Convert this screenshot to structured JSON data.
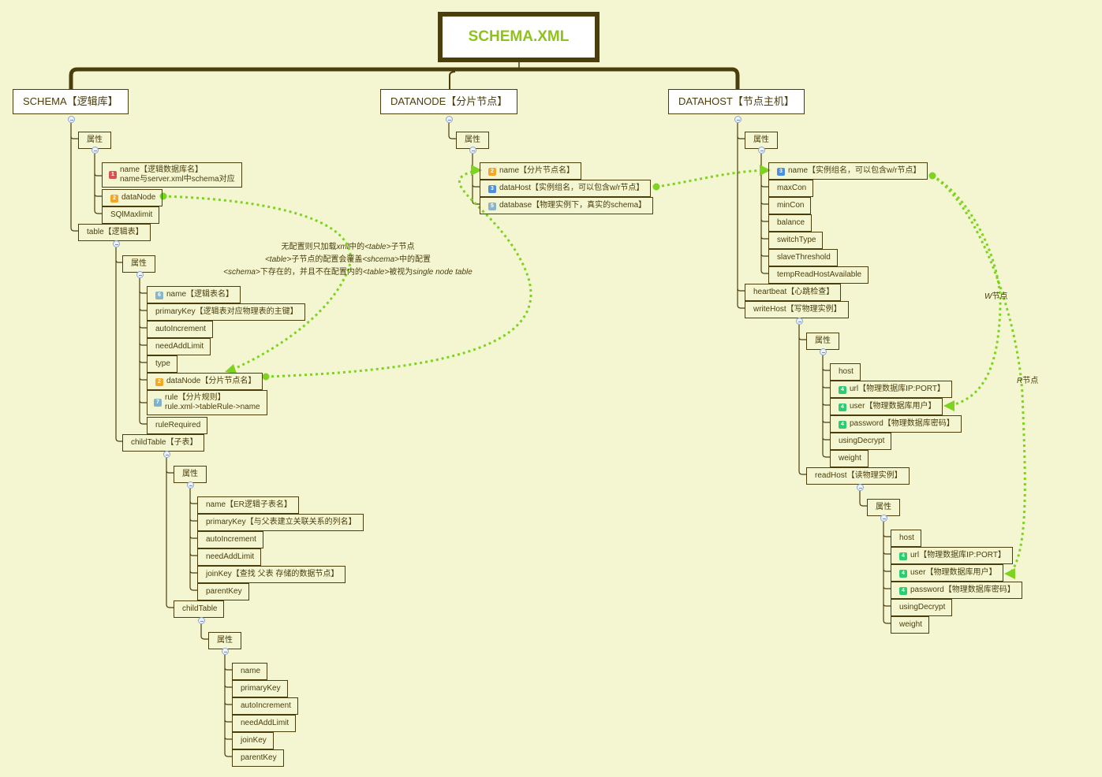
{
  "root": {
    "title": "SCHEMA.XML",
    "title_color": "#8fc21b"
  },
  "colors": {
    "line": "#4a3e0c",
    "relationship": "#7ed321",
    "background": "#f4f6d2"
  },
  "schema": {
    "title": "SCHEMA【逻辑库】",
    "attrs_label": "属性",
    "attrs": [
      {
        "badge": "1",
        "badge_color": "#d9534f",
        "line1": "name【逻辑数据库名】",
        "line2": "name与server.xml中schema对应"
      },
      {
        "badge": "2",
        "badge_color": "#f5a623",
        "label": "dataNode"
      },
      {
        "label": "SQlMaxlimit"
      }
    ],
    "table": {
      "title": "table【逻辑表】",
      "attrs_label": "属性",
      "attrs": [
        {
          "badge": "6",
          "badge_color": "#8ab4c8",
          "label": "name【逻辑表名】"
        },
        {
          "label": "primaryKey【逻辑表对应物理表的主键】"
        },
        {
          "label": "autoIncrement"
        },
        {
          "label": "needAddLimit"
        },
        {
          "label": "type"
        },
        {
          "badge": "2",
          "badge_color": "#f5a623",
          "label": "dataNode【分片节点名】"
        },
        {
          "badge": "7",
          "badge_color": "#7fb3cc",
          "line1": "rule【分片规则】",
          "line2": "rule.xml->tableRule->name"
        },
        {
          "label": "ruleRequired"
        }
      ],
      "childTable": {
        "title": "childTable【子表】",
        "attrs_label": "属性",
        "attrs": [
          {
            "label": "name【ER逻辑子表名】"
          },
          {
            "label": "primaryKey【与父表建立关联关系的列名】"
          },
          {
            "label": "autoIncrement"
          },
          {
            "label": "needAddLimit"
          },
          {
            "label": "joinKey【查找 父表 存储的数据节点】"
          },
          {
            "label": "parentKey"
          }
        ],
        "childTable": {
          "title": "childTable",
          "attrs_label": "属性",
          "attrs": [
            {
              "label": "name"
            },
            {
              "label": "primaryKey"
            },
            {
              "label": "autoIncrement"
            },
            {
              "label": "needAddLimit"
            },
            {
              "label": "joinKey"
            },
            {
              "label": "parentKey"
            }
          ]
        }
      }
    }
  },
  "datanode": {
    "title": "DATANODE【分片节点】",
    "attrs_label": "属性",
    "attrs": [
      {
        "badge": "2",
        "badge_color": "#f5a623",
        "label": "name【分片节点名】"
      },
      {
        "badge": "3",
        "badge_color": "#4a90e2",
        "label": "dataHost【实例组名，可以包含w/r节点】"
      },
      {
        "badge": "5",
        "badge_color": "#8ab4c8",
        "label": "database【物理实例下，真实的schema】"
      }
    ]
  },
  "datahost": {
    "title": "DATAHOST【节点主机】",
    "attrs_label": "属性",
    "attrs": [
      {
        "badge": "3",
        "badge_color": "#4a90e2",
        "label": "name【实例组名，可以包含w/r节点】"
      },
      {
        "label": "maxCon"
      },
      {
        "label": "minCon"
      },
      {
        "label": "balance"
      },
      {
        "label": "switchType"
      },
      {
        "label": "slaveThreshold"
      },
      {
        "label": "tempReadHostAvailable"
      }
    ],
    "heartbeat": "heartbeat【心跳检查】",
    "writeHost": {
      "title": "writeHost【写物理实例】",
      "attrs_label": "属性",
      "attrs": [
        {
          "label": "host"
        },
        {
          "badge": "4",
          "badge_color": "#2ecc71",
          "label": "url【物理数据库IP:PORT】"
        },
        {
          "badge": "4",
          "badge_color": "#2ecc71",
          "label": "user【物理数据库用户】"
        },
        {
          "badge": "4",
          "badge_color": "#2ecc71",
          "label": "password【物理数据库密码】"
        },
        {
          "label": "usingDecrypt"
        },
        {
          "label": "weight"
        }
      ],
      "readHost": {
        "title": "readHost【读物理实例】",
        "attrs_label": "属性",
        "attrs": [
          {
            "label": "host"
          },
          {
            "badge": "4",
            "badge_color": "#2ecc71",
            "label": "url【物理数据库IP:PORT】"
          },
          {
            "badge": "4",
            "badge_color": "#2ecc71",
            "label": "user【物理数据库用户】"
          },
          {
            "badge": "4",
            "badge_color": "#2ecc71",
            "label": "password【物理数据库密码】"
          },
          {
            "label": "usingDecrypt"
          },
          {
            "label": "weight"
          }
        ]
      }
    }
  },
  "annotation": {
    "line1_pre": "无配置则只加载",
    "line1_em": "xml",
    "line1_mid": "中的",
    "line1_em2": "<table>",
    "line1_post": "子节点",
    "line2_em": "<table>",
    "line2_mid": "子节点的配置会覆盖",
    "line2_em2": "<shcema>",
    "line2_post": "中的配置",
    "line3_em": "<schema>",
    "line3_mid": "下存在的，并且不在配置内的",
    "line3_em2": "<table>",
    "line3_mid2": "被视为",
    "line3_em3": "single node table"
  },
  "relations": {
    "w_label_em": "W",
    "w_label": "节点",
    "r_label_em": "R",
    "r_label": "节点"
  }
}
